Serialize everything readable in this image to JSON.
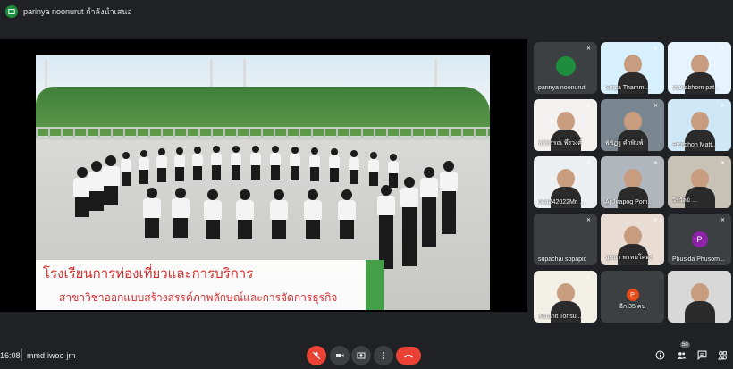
{
  "topbar": {
    "presenter_label": "parinya noonurut กำลังนำเสนอ"
  },
  "slide": {
    "caption_line1": "โรงเรียนการท่องเที่ยวและการบริการ",
    "caption_line2": "สาขาวิชาออกแบบสร้างสรรค์ภาพลักษณ์และการจัดการธุรกิจ"
  },
  "participants": [
    {
      "name": "parinya noonurut",
      "kind": "avatar",
      "color": "#1e8e3e",
      "letter": ""
    },
    {
      "name": "Siripa Thammi...",
      "kind": "camera",
      "color": "#d7f0ff",
      "letter": ""
    },
    {
      "name": "thanabhorn pat...",
      "kind": "camera",
      "color": "#e6f4ff",
      "letter": ""
    },
    {
      "name": "พรพรรณ พึ่งวงศ์",
      "kind": "camera",
      "color": "#f3f1ef",
      "letter": ""
    },
    {
      "name": "พิชิฏฐ คำพิมพ์",
      "kind": "camera",
      "color": "#7b8790",
      "letter": ""
    },
    {
      "name": "Pisitphon Matt...",
      "kind": "camera",
      "color": "#cfe8f7",
      "letter": ""
    },
    {
      "name": "604242022Mr. ...",
      "kind": "camera",
      "color": "#eceff1",
      "letter": ""
    },
    {
      "name": "Aj Jirapog Pom...",
      "kind": "camera",
      "color": "#b0b6bb",
      "letter": ""
    },
    {
      "name": "วีรวัลย์ ...",
      "kind": "camera",
      "color": "#c7c1b6",
      "letter": ""
    },
    {
      "name": "supachai sopapid",
      "kind": "avatar",
      "color": "#3c4043",
      "letter": ""
    },
    {
      "name": "บุษบา พรหมโคตร",
      "kind": "camera",
      "color": "#e9dcd3",
      "letter": ""
    },
    {
      "name": "Phusida Phusom...",
      "kind": "letter",
      "color": "#8e24aa",
      "letter": "P"
    },
    {
      "name": "Koranit Tonsu...",
      "kind": "camera",
      "color": "#f2efe6",
      "letter": ""
    },
    {
      "name": "อีก 35 คน",
      "kind": "more",
      "color": "#3c4043",
      "letter": "P"
    },
    {
      "name": "",
      "kind": "camera",
      "color": "#d8d8d8",
      "letter": ""
    }
  ],
  "bottombar": {
    "time": "16:08",
    "meeting_code": "mmd-iwoe-jrn",
    "people_count": "50"
  }
}
